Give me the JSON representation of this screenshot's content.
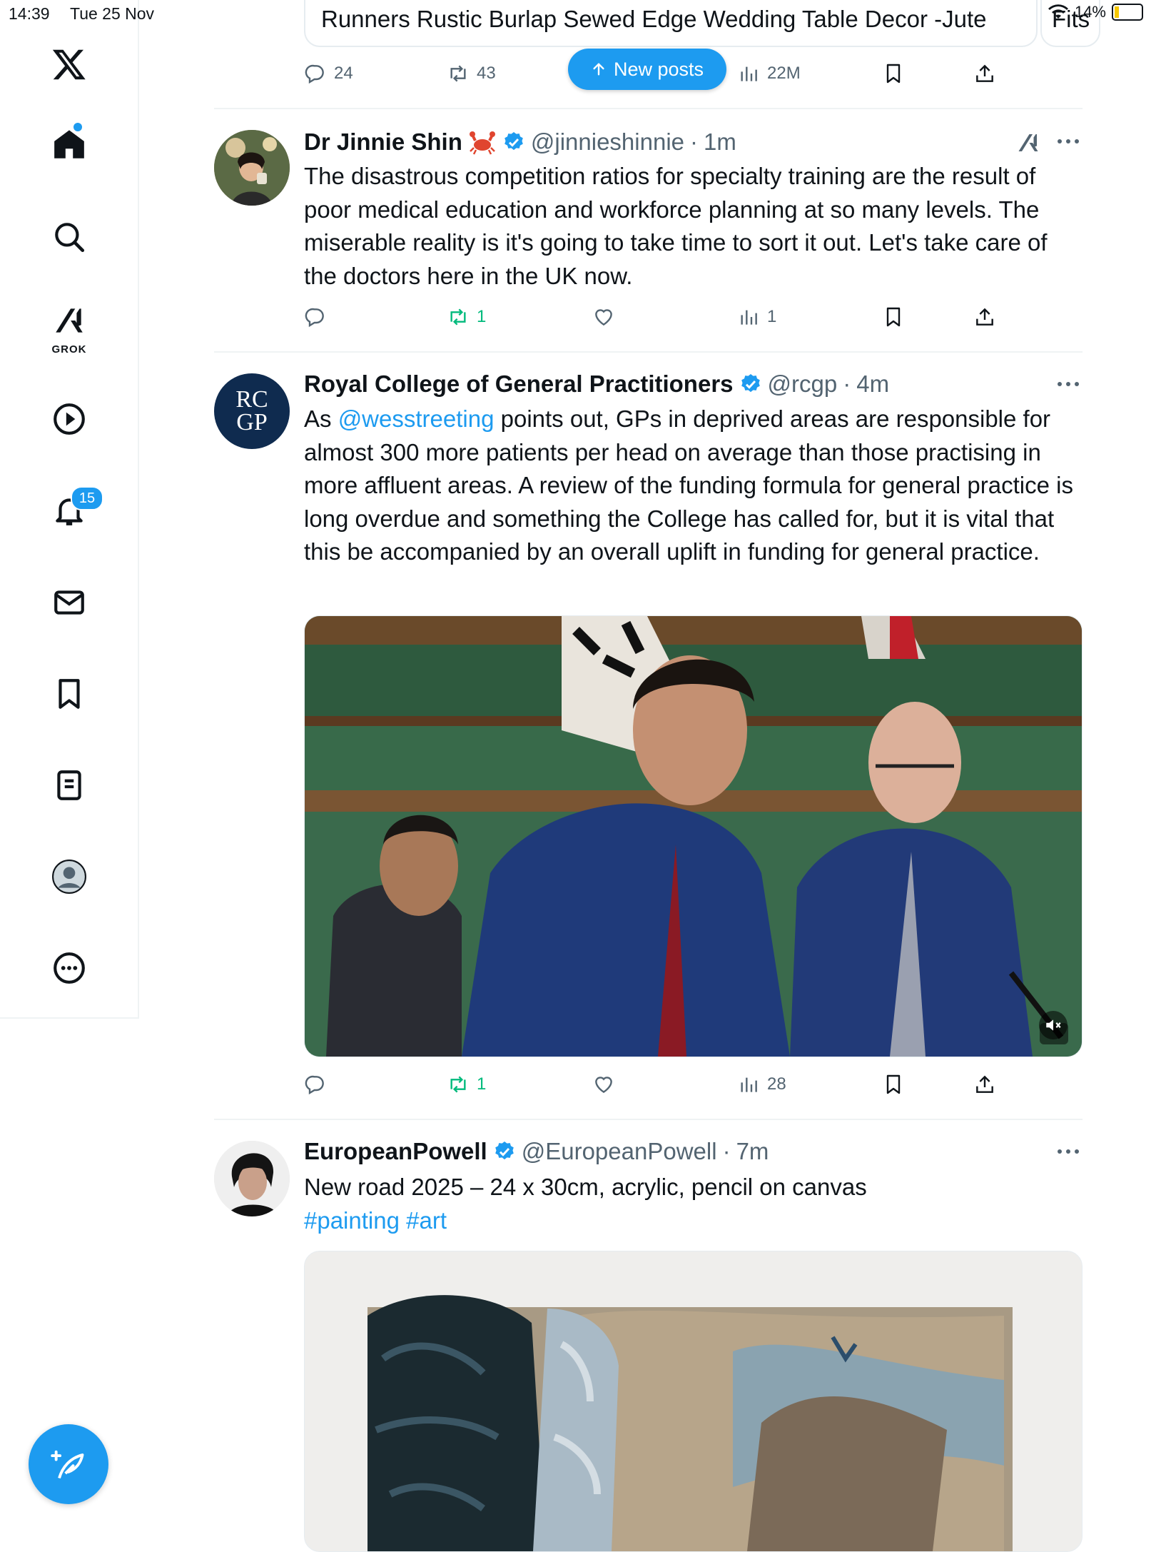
{
  "status_bar": {
    "time": "14:39",
    "date": "Tue 25 Nov",
    "battery": "14%"
  },
  "sidebar": {
    "grok_label": "GROK",
    "notification_count": "15"
  },
  "previous_post": {
    "card_text": "Runners Rustic Burlap Sewed Edge Wedding Table Decor -Jute",
    "card_text_2": "Fits",
    "replies": "24",
    "reposts": "43",
    "views": "22M"
  },
  "new_posts_label": "New posts",
  "posts": [
    {
      "name": "Dr Jinnie Shin",
      "handle": "@jinnieshinnie",
      "time": "1m",
      "text": "The disastrous competition ratios for specialty training are the result of poor medical education and workforce planning at so many levels. The miserable reality is it's going to take time to sort it out. Let's take care of the doctors here in the UK now.",
      "reposts": "1",
      "views": "1"
    },
    {
      "name": "Royal College of General Practitioners",
      "handle": "@rcgp",
      "time": "4m",
      "avatar_text": [
        "RC",
        "GP"
      ],
      "text_prefix": "As ",
      "mention": "@wesstreeting",
      "text_suffix": " points out, GPs in deprived areas are responsible for almost 300 more patients per head on average than those practising in more affluent areas. A review of the funding formula for general practice is long overdue and something the College has called for, but it is vital that this be accompanied by an overall uplift in funding for general practice.",
      "reposts": "1",
      "views": "28"
    },
    {
      "name": "EuropeanPowell",
      "handle": "@EuropeanPowell",
      "time": "7m",
      "text": "New road 2025 – 24 x 30cm, acrylic, pencil on canvas",
      "hashtags": "#painting #art"
    }
  ],
  "separator": "·",
  "colors": {
    "accent": "#1d9bf0",
    "repost_green": "#00ba7c",
    "muted": "#536471"
  }
}
